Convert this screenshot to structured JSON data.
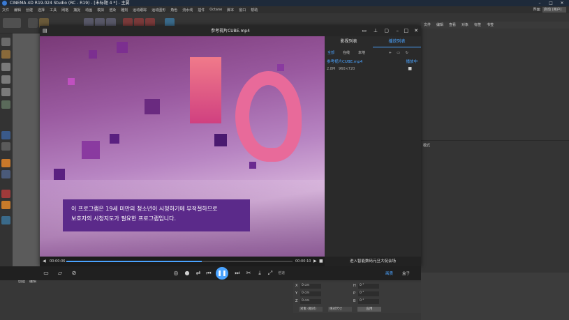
{
  "window": {
    "title": "CINEMA 4D R19.024 Studio (RC - R19) - [未标题 4 *] - 主要"
  },
  "menu": [
    "文件",
    "编辑",
    "创建",
    "选择",
    "工具",
    "网格",
    "捕捉",
    "动画",
    "模拟",
    "渲染",
    "雕刻",
    "运动跟踪",
    "运动图形",
    "角色",
    "流水线",
    "插件",
    "Octane",
    "脚本",
    "窗口",
    "帮助"
  ],
  "layout": {
    "label": "界面:",
    "value": "启动 (用户)"
  },
  "objpanel": {
    "tabs": [
      "文件",
      "编辑",
      "查看",
      "对象",
      "标签",
      "书签"
    ]
  },
  "attrpanel": {
    "label": "模式"
  },
  "player": {
    "title": "参考视片CUBE.mp4",
    "playlist_tabs": [
      "影视列表",
      "播放列表"
    ],
    "filters": [
      "全部",
      "在线",
      "本地"
    ],
    "item": {
      "name": "参考视片CUBE.mp4",
      "status": "播放中",
      "size": "2.8M",
      "resolution": "960×720"
    },
    "subtitle_lines": [
      "이 프로그램은 19세 미만의 청소년이 시청하기에 부적절하므로",
      "보호자의 시청지도가 필요한 프로그램입니다."
    ],
    "time_current": "00:00:06",
    "time_total": "00:00:10",
    "status_text": "进入智能数码元旦大促会场",
    "quality_label": "画质",
    "speed_label": "倍速",
    "box_label": "盒子",
    "progress": 0.6
  },
  "bottom": {
    "tabs": [
      "创建",
      "编辑"
    ],
    "frame": "0 F",
    "apply": "应用",
    "coord_labels": [
      "X",
      "Y",
      "Z"
    ],
    "size_labels": [
      "H",
      "P",
      "B"
    ],
    "coord_values": [
      "0 cm",
      "0 cm",
      "0 cm"
    ],
    "angle_values": [
      "0 °",
      "0 °",
      "0 °"
    ],
    "mode_a": "对象 (相对)",
    "mode_b": "绝对尺寸"
  }
}
